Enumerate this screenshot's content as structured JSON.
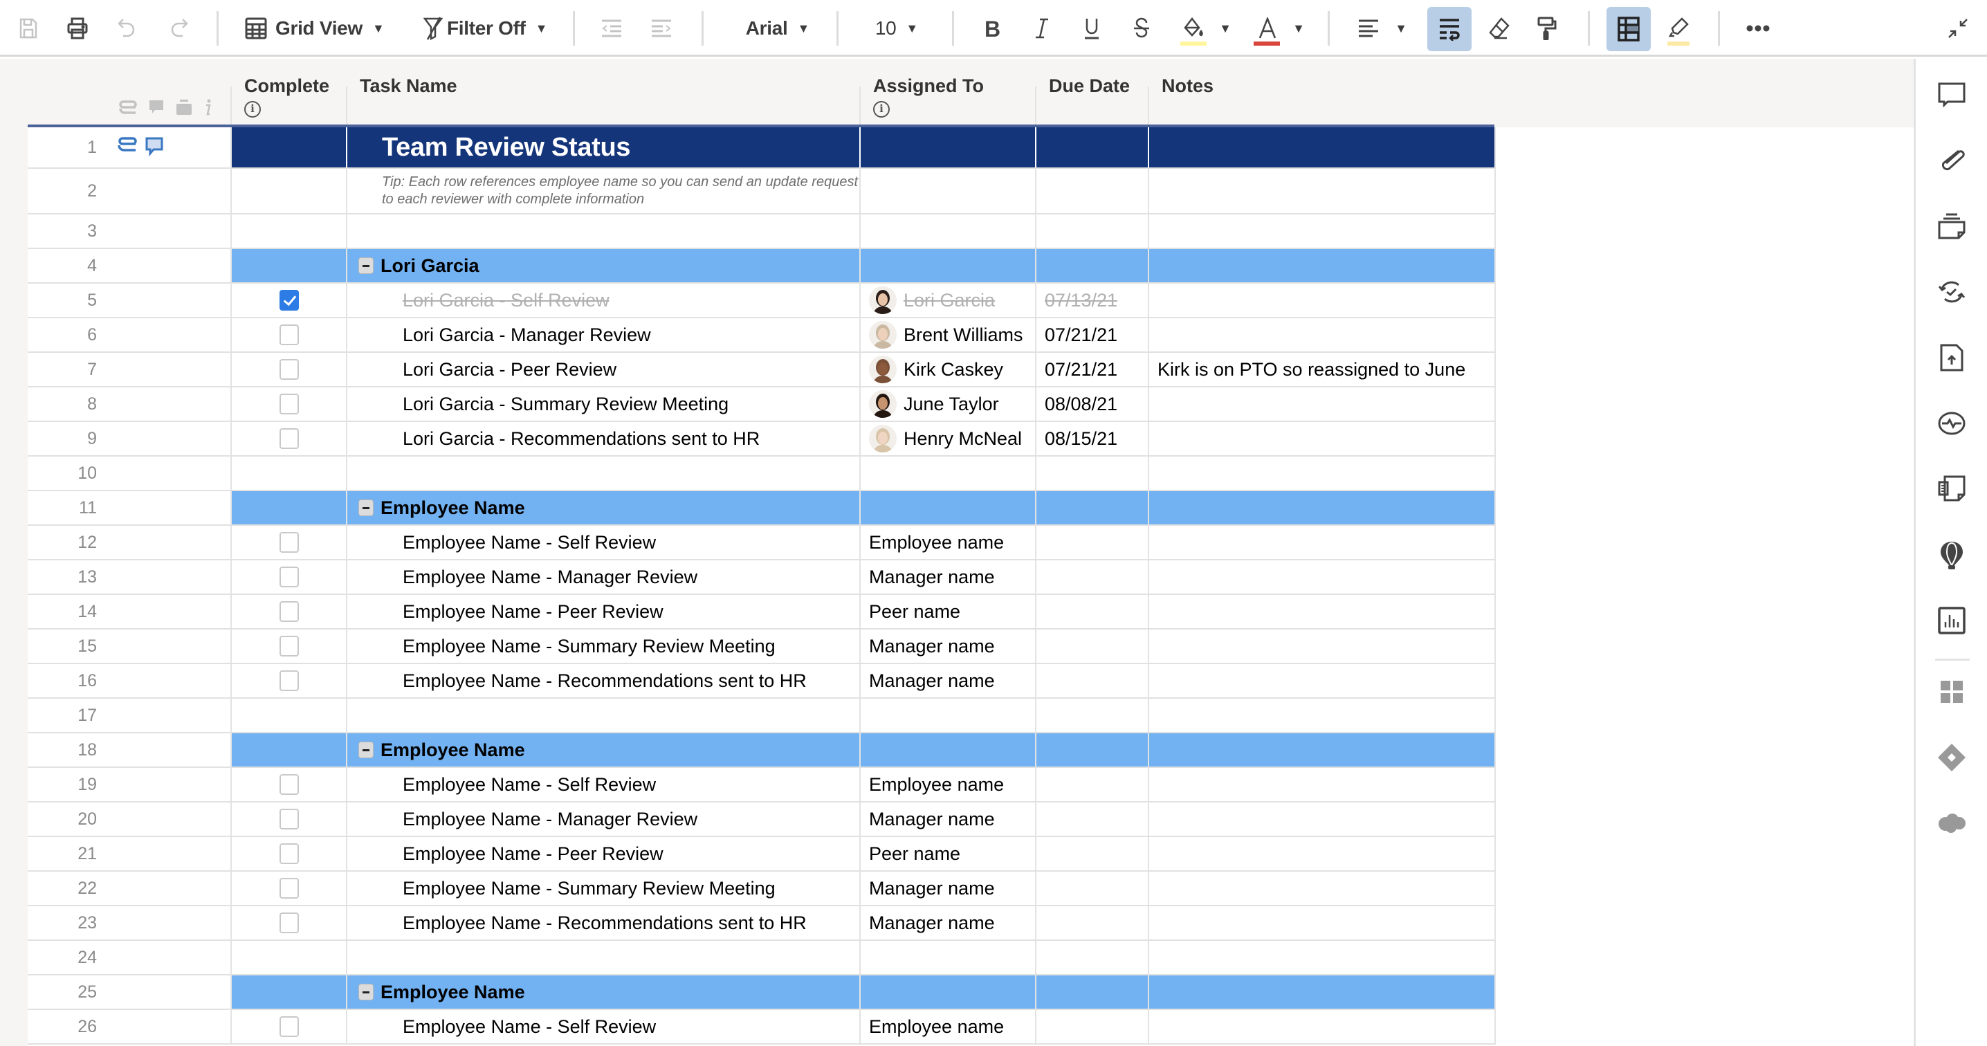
{
  "toolbar": {
    "save": "save-icon",
    "print": "print-icon",
    "undo": "undo-icon",
    "redo": "redo-icon",
    "view_label": "Grid View",
    "filter_label": "Filter Off",
    "font_family": "Arial",
    "font_size": "10",
    "colors": {
      "fill_swatch": "#fff59d",
      "text_swatch": "#d9453a",
      "highlight_swatch": "#fde9a6",
      "active_bg": "#b8cde6"
    }
  },
  "columns": {
    "complete": "Complete",
    "task": "Task Name",
    "assigned": "Assigned To",
    "due": "Due Date",
    "notes": "Notes"
  },
  "colors": {
    "title_bg": "#14357a",
    "group_bg": "#72b2f2",
    "check_blue": "#2d7ce6"
  },
  "rows": [
    {
      "num": "1",
      "type": "title",
      "task": "Team Review Status"
    },
    {
      "num": "2",
      "type": "tip",
      "task": "Tip: Each row references employee name so you can send an update request to each reviewer with complete information"
    },
    {
      "num": "3",
      "type": "blank"
    },
    {
      "num": "4",
      "type": "group",
      "task": "Lori Garcia"
    },
    {
      "num": "5",
      "type": "task",
      "complete": true,
      "task": "Lori Garcia - Self Review",
      "assigned": "Lori Garcia",
      "avatar": "female-dark-hair",
      "due": "07/13/21",
      "notes": ""
    },
    {
      "num": "6",
      "type": "task",
      "complete": false,
      "task": "Lori Garcia - Manager Review",
      "assigned": "Brent Williams",
      "avatar": "male-glasses",
      "due": "07/21/21",
      "notes": ""
    },
    {
      "num": "7",
      "type": "task",
      "complete": false,
      "task": "Lori Garcia - Peer Review",
      "assigned": "Kirk Caskey",
      "avatar": "male-bald",
      "due": "07/21/21",
      "notes": "Kirk is on PTO so reassigned to June"
    },
    {
      "num": "8",
      "type": "task",
      "complete": false,
      "task": "Lori Garcia - Summary Review Meeting",
      "assigned": "June Taylor",
      "avatar": "female-long-hair",
      "due": "08/08/21",
      "notes": ""
    },
    {
      "num": "9",
      "type": "task",
      "complete": false,
      "task": "Lori Garcia - Recommendations sent to HR",
      "assigned": "Henry McNeal",
      "avatar": "male-light-hair",
      "due": "08/15/21",
      "notes": ""
    },
    {
      "num": "10",
      "type": "blank"
    },
    {
      "num": "11",
      "type": "group",
      "task": "Employee Name"
    },
    {
      "num": "12",
      "type": "task",
      "complete": false,
      "task": "Employee Name - Self Review",
      "assigned": "Employee name"
    },
    {
      "num": "13",
      "type": "task",
      "complete": false,
      "task": "Employee Name - Manager Review",
      "assigned": "Manager name"
    },
    {
      "num": "14",
      "type": "task",
      "complete": false,
      "task": "Employee Name - Peer Review",
      "assigned": "Peer name"
    },
    {
      "num": "15",
      "type": "task",
      "complete": false,
      "task": "Employee Name - Summary Review Meeting",
      "assigned": "Manager name"
    },
    {
      "num": "16",
      "type": "task",
      "complete": false,
      "task": "Employee Name - Recommendations sent to HR",
      "assigned": "Manager name"
    },
    {
      "num": "17",
      "type": "blank"
    },
    {
      "num": "18",
      "type": "group",
      "task": "Employee Name"
    },
    {
      "num": "19",
      "type": "task",
      "complete": false,
      "task": "Employee Name - Self Review",
      "assigned": "Employee name"
    },
    {
      "num": "20",
      "type": "task",
      "complete": false,
      "task": "Employee Name - Manager Review",
      "assigned": "Manager name"
    },
    {
      "num": "21",
      "type": "task",
      "complete": false,
      "task": "Employee Name - Peer Review",
      "assigned": "Peer name"
    },
    {
      "num": "22",
      "type": "task",
      "complete": false,
      "task": "Employee Name - Summary Review Meeting",
      "assigned": "Manager name"
    },
    {
      "num": "23",
      "type": "task",
      "complete": false,
      "task": "Employee Name - Recommendations sent to HR",
      "assigned": "Manager name"
    },
    {
      "num": "24",
      "type": "blank"
    },
    {
      "num": "25",
      "type": "group",
      "task": "Employee Name"
    },
    {
      "num": "26",
      "type": "task",
      "complete": false,
      "task": "Employee Name - Self Review",
      "assigned": "Employee name"
    }
  ],
  "sidebar": [
    "comments-icon",
    "attachments-icon",
    "proofs-icon",
    "update-requests-icon",
    "publish-icon",
    "activity-log-icon",
    "summary-icon",
    "brandfolder-icon",
    "dashboard-chart-icon",
    "apps-grid-icon",
    "jira-icon",
    "salesforce-icon"
  ]
}
